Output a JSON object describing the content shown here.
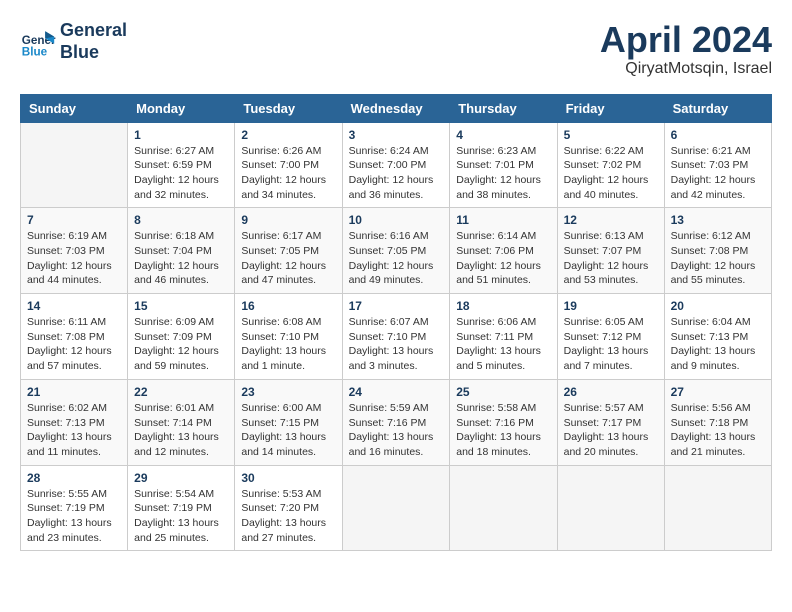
{
  "logo": {
    "line1": "General",
    "line2": "Blue"
  },
  "title": "April 2024",
  "location": "QiryatMotsqin, Israel",
  "days_of_week": [
    "Sunday",
    "Monday",
    "Tuesday",
    "Wednesday",
    "Thursday",
    "Friday",
    "Saturday"
  ],
  "weeks": [
    [
      {
        "day": "",
        "info": ""
      },
      {
        "day": "1",
        "info": "Sunrise: 6:27 AM\nSunset: 6:59 PM\nDaylight: 12 hours\nand 32 minutes."
      },
      {
        "day": "2",
        "info": "Sunrise: 6:26 AM\nSunset: 7:00 PM\nDaylight: 12 hours\nand 34 minutes."
      },
      {
        "day": "3",
        "info": "Sunrise: 6:24 AM\nSunset: 7:00 PM\nDaylight: 12 hours\nand 36 minutes."
      },
      {
        "day": "4",
        "info": "Sunrise: 6:23 AM\nSunset: 7:01 PM\nDaylight: 12 hours\nand 38 minutes."
      },
      {
        "day": "5",
        "info": "Sunrise: 6:22 AM\nSunset: 7:02 PM\nDaylight: 12 hours\nand 40 minutes."
      },
      {
        "day": "6",
        "info": "Sunrise: 6:21 AM\nSunset: 7:03 PM\nDaylight: 12 hours\nand 42 minutes."
      }
    ],
    [
      {
        "day": "7",
        "info": "Sunrise: 6:19 AM\nSunset: 7:03 PM\nDaylight: 12 hours\nand 44 minutes."
      },
      {
        "day": "8",
        "info": "Sunrise: 6:18 AM\nSunset: 7:04 PM\nDaylight: 12 hours\nand 46 minutes."
      },
      {
        "day": "9",
        "info": "Sunrise: 6:17 AM\nSunset: 7:05 PM\nDaylight: 12 hours\nand 47 minutes."
      },
      {
        "day": "10",
        "info": "Sunrise: 6:16 AM\nSunset: 7:05 PM\nDaylight: 12 hours\nand 49 minutes."
      },
      {
        "day": "11",
        "info": "Sunrise: 6:14 AM\nSunset: 7:06 PM\nDaylight: 12 hours\nand 51 minutes."
      },
      {
        "day": "12",
        "info": "Sunrise: 6:13 AM\nSunset: 7:07 PM\nDaylight: 12 hours\nand 53 minutes."
      },
      {
        "day": "13",
        "info": "Sunrise: 6:12 AM\nSunset: 7:08 PM\nDaylight: 12 hours\nand 55 minutes."
      }
    ],
    [
      {
        "day": "14",
        "info": "Sunrise: 6:11 AM\nSunset: 7:08 PM\nDaylight: 12 hours\nand 57 minutes."
      },
      {
        "day": "15",
        "info": "Sunrise: 6:09 AM\nSunset: 7:09 PM\nDaylight: 12 hours\nand 59 minutes."
      },
      {
        "day": "16",
        "info": "Sunrise: 6:08 AM\nSunset: 7:10 PM\nDaylight: 13 hours\nand 1 minute."
      },
      {
        "day": "17",
        "info": "Sunrise: 6:07 AM\nSunset: 7:10 PM\nDaylight: 13 hours\nand 3 minutes."
      },
      {
        "day": "18",
        "info": "Sunrise: 6:06 AM\nSunset: 7:11 PM\nDaylight: 13 hours\nand 5 minutes."
      },
      {
        "day": "19",
        "info": "Sunrise: 6:05 AM\nSunset: 7:12 PM\nDaylight: 13 hours\nand 7 minutes."
      },
      {
        "day": "20",
        "info": "Sunrise: 6:04 AM\nSunset: 7:13 PM\nDaylight: 13 hours\nand 9 minutes."
      }
    ],
    [
      {
        "day": "21",
        "info": "Sunrise: 6:02 AM\nSunset: 7:13 PM\nDaylight: 13 hours\nand 11 minutes."
      },
      {
        "day": "22",
        "info": "Sunrise: 6:01 AM\nSunset: 7:14 PM\nDaylight: 13 hours\nand 12 minutes."
      },
      {
        "day": "23",
        "info": "Sunrise: 6:00 AM\nSunset: 7:15 PM\nDaylight: 13 hours\nand 14 minutes."
      },
      {
        "day": "24",
        "info": "Sunrise: 5:59 AM\nSunset: 7:16 PM\nDaylight: 13 hours\nand 16 minutes."
      },
      {
        "day": "25",
        "info": "Sunrise: 5:58 AM\nSunset: 7:16 PM\nDaylight: 13 hours\nand 18 minutes."
      },
      {
        "day": "26",
        "info": "Sunrise: 5:57 AM\nSunset: 7:17 PM\nDaylight: 13 hours\nand 20 minutes."
      },
      {
        "day": "27",
        "info": "Sunrise: 5:56 AM\nSunset: 7:18 PM\nDaylight: 13 hours\nand 21 minutes."
      }
    ],
    [
      {
        "day": "28",
        "info": "Sunrise: 5:55 AM\nSunset: 7:19 PM\nDaylight: 13 hours\nand 23 minutes."
      },
      {
        "day": "29",
        "info": "Sunrise: 5:54 AM\nSunset: 7:19 PM\nDaylight: 13 hours\nand 25 minutes."
      },
      {
        "day": "30",
        "info": "Sunrise: 5:53 AM\nSunset: 7:20 PM\nDaylight: 13 hours\nand 27 minutes."
      },
      {
        "day": "",
        "info": ""
      },
      {
        "day": "",
        "info": ""
      },
      {
        "day": "",
        "info": ""
      },
      {
        "day": "",
        "info": ""
      }
    ]
  ]
}
